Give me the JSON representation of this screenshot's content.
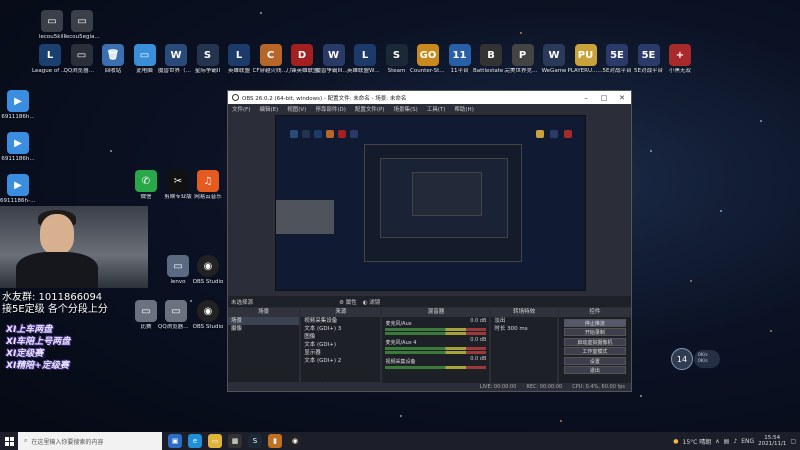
{
  "desktop": {
    "top_icons": [
      {
        "label": "lecou5kill"
      },
      {
        "label": "lecou5egia..."
      }
    ],
    "row_icons": [
      {
        "label": "League of Legends",
        "color": "#1b3f6e",
        "glyph": "L"
      },
      {
        "label": "QQ浏览器截图20210B2...",
        "color": "#2b2f3a",
        "glyph": "▭"
      },
      {
        "label": "回收站",
        "color": "#3b6fb0",
        "glyph": "🗑"
      },
      {
        "label": "此电脑",
        "color": "#3a8fd9",
        "glyph": "▭"
      },
      {
        "label": "魔兽世界（经典怀旧服）",
        "color": "#2a4b7a",
        "glyph": "W"
      },
      {
        "label": "星际争霸II",
        "color": "#24344f",
        "glyph": "S"
      },
      {
        "label": "英雄联盟",
        "color": "#1c3b6a",
        "glyph": "L"
      },
      {
        "label": "CF穿越火线大区",
        "color": "#b7662a",
        "glyph": "C"
      },
      {
        "label": "刀锋英雄联盟",
        "color": "#a32020",
        "glyph": "D"
      },
      {
        "label": "魔兽争霸III对战平台",
        "color": "#2a3a66",
        "glyph": "W"
      },
      {
        "label": "英雄联盟WeGame版",
        "color": "#1c3b6a",
        "glyph": "L"
      },
      {
        "label": "Steam",
        "color": "#1b2838",
        "glyph": "S"
      },
      {
        "label": "Counter-Strike: Global Off...",
        "color": "#c88a1f",
        "glyph": "GO"
      },
      {
        "label": "11平台",
        "color": "#2860a8",
        "glyph": "11"
      },
      {
        "label": "Battlestate Games L...",
        "color": "#333",
        "glyph": "B"
      },
      {
        "label": "完美世界竞技平台",
        "color": "#444",
        "glyph": "P"
      },
      {
        "label": "WeGame",
        "color": "#2a3a5a",
        "glyph": "W"
      },
      {
        "label": "PLAYERU... BATTLEGR...",
        "color": "#c9a33a",
        "glyph": "PU"
      },
      {
        "label": "5E对战平台",
        "color": "#2a3a6a",
        "glyph": "5E"
      },
      {
        "label": "5E对战平台",
        "color": "#2a3a6a",
        "glyph": "5E"
      },
      {
        "label": "小黑无双",
        "color": "#a82a2a",
        "glyph": "+"
      }
    ],
    "left_icons": [
      {
        "label": "6911186h..."
      },
      {
        "label": "6911186h..."
      },
      {
        "label": "6911186h-h..."
      }
    ],
    "mid_icons": [
      {
        "label": "微信",
        "color": "#2aa748",
        "glyph": "✆"
      },
      {
        "label": "剪映专业版",
        "color": "#111",
        "glyph": "✂"
      },
      {
        "label": "网易云音乐",
        "color": "#e55a1f",
        "glyph": "♫"
      }
    ],
    "low_icons": [
      {
        "label": "比赛"
      },
      {
        "label": "QQ浏览器截图2021021..."
      },
      {
        "label": "OBS Studio"
      }
    ],
    "more_icons": [
      {
        "label": "lenvo"
      },
      {
        "label": "OBS Studio"
      }
    ]
  },
  "stream": {
    "qq_group": "水友群: 1011866094",
    "promo": "接5E定级  各个分段上分",
    "tags": [
      "XI上车两盘",
      "XI车陪上号两盘",
      "XI定级赛",
      "XI精陪+定级赛"
    ]
  },
  "obs": {
    "title": "OBS 26.0.2 (64-bit, windows) - 配置文件: 未命名 - 场景: 未命名",
    "menus": [
      "文件(F)",
      "编辑(E)",
      "视图(V)",
      "停靠部件(D)",
      "配置文件(P)",
      "场景集(S)",
      "工具(T)",
      "帮助(H)"
    ],
    "source_bar": {
      "label": "未选择源",
      "props": "属性",
      "filter": "滤镜"
    },
    "scenes": {
      "header": "场景",
      "items": [
        "场景",
        "摄像"
      ]
    },
    "sources": {
      "header": "来源",
      "items": [
        "视频采集设备",
        "文本 (GDI+) 3",
        "图像",
        "文本 (GDI+)",
        "显示器",
        "文本 (GDI+) 2"
      ]
    },
    "mixer": {
      "header": "混音器",
      "channels": [
        {
          "name": "麦克风/Aux",
          "db": "0.0 dB"
        },
        {
          "name": "麦克风/Aux 4",
          "db": "0.0 dB"
        },
        {
          "name": "视频采集设备",
          "db": "0.0 dB"
        }
      ]
    },
    "transitions": {
      "header": "转场特效",
      "type": "淡出",
      "duration_label": "时长",
      "duration": "300 ms"
    },
    "controls": {
      "header": "控件",
      "buttons": [
        "停止推流",
        "开始录制",
        "启动虚拟摄像机",
        "工作室模式",
        "设置",
        "退出"
      ]
    },
    "status": {
      "live": "LIVE: 00:00:00",
      "rec": "REC: 00:00:00",
      "cpu": "CPU: 0.4%, 60.00 fps"
    }
  },
  "taskbar": {
    "search_placeholder": "在这里输入你要搜索的内容",
    "weather": "15°C  晴朗",
    "lang": "ENG",
    "time": "15:54",
    "date": "2021/11/1"
  },
  "floating": {
    "badge": "14",
    "pill_top": "0K/s",
    "pill_bottom": "0K/s"
  }
}
